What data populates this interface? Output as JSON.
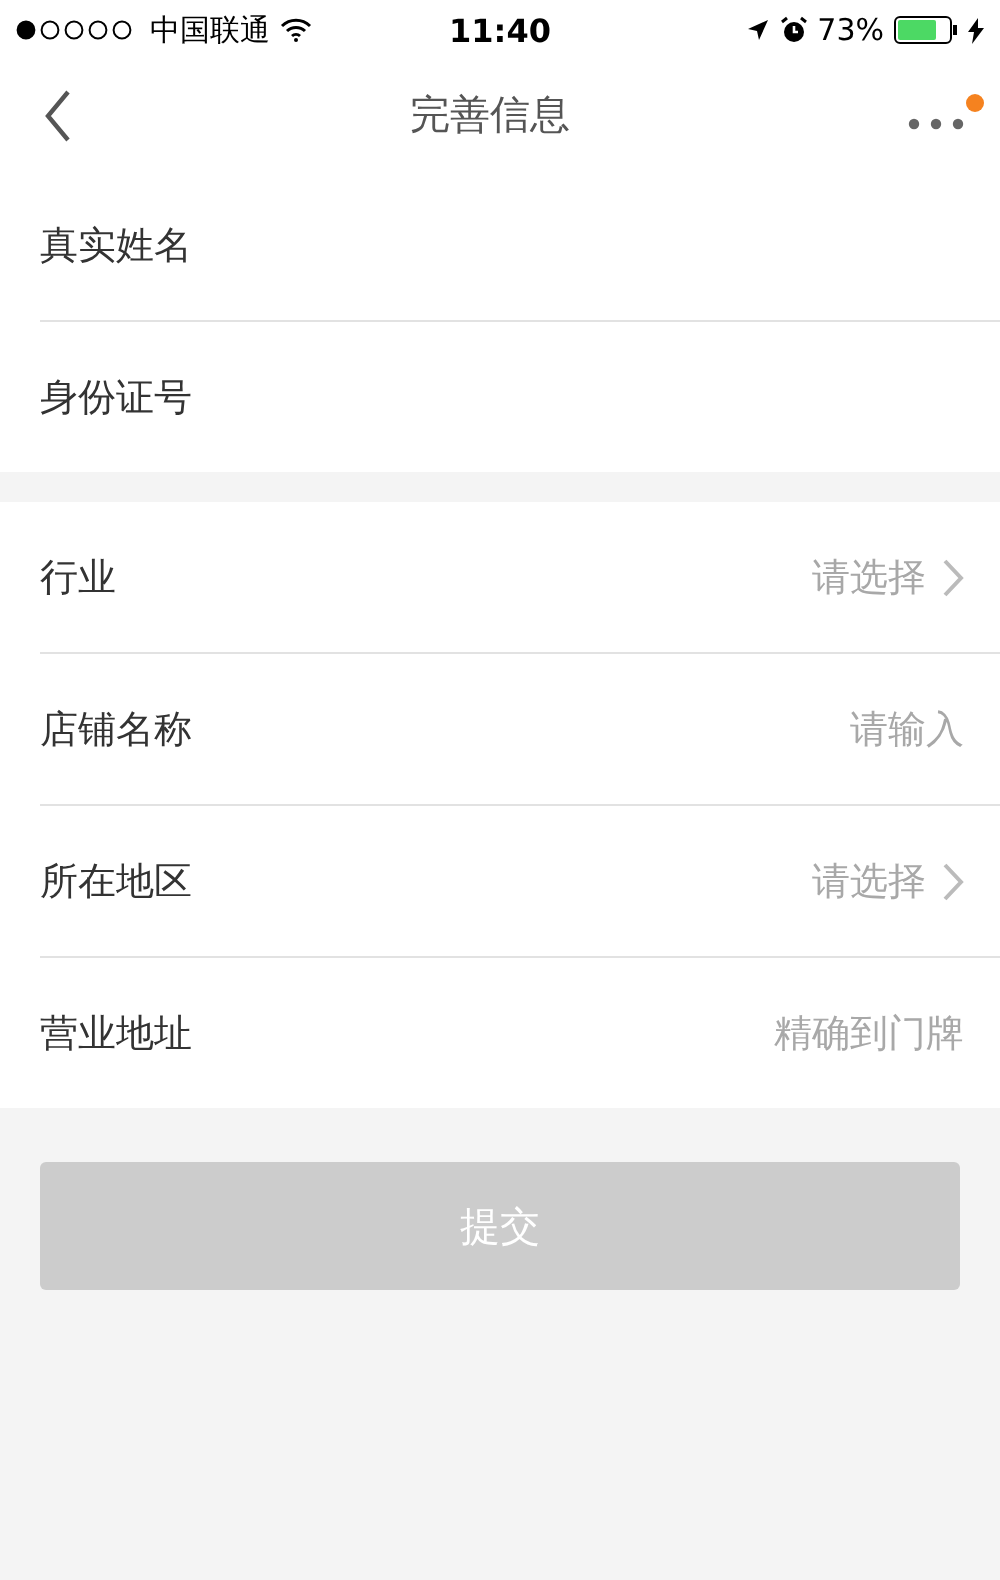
{
  "status_bar": {
    "carrier": "中国联通",
    "time": "11:40",
    "battery": "73%"
  },
  "nav": {
    "title": "完善信息",
    "has_notification": true
  },
  "groups": [
    {
      "rows": [
        {
          "kind": "input",
          "label": "真实姓名"
        },
        {
          "kind": "input",
          "label": "身份证号"
        }
      ]
    },
    {
      "rows": [
        {
          "kind": "select",
          "label": "行业",
          "hint": "请选择"
        },
        {
          "kind": "input",
          "label": "店铺名称",
          "placeholder": "请输入"
        },
        {
          "kind": "select",
          "label": "所在地区",
          "hint": "请选择"
        },
        {
          "kind": "input",
          "label": "营业地址",
          "placeholder": "精确到门牌"
        }
      ]
    }
  ],
  "submit": {
    "label": "提交",
    "disabled": true
  }
}
